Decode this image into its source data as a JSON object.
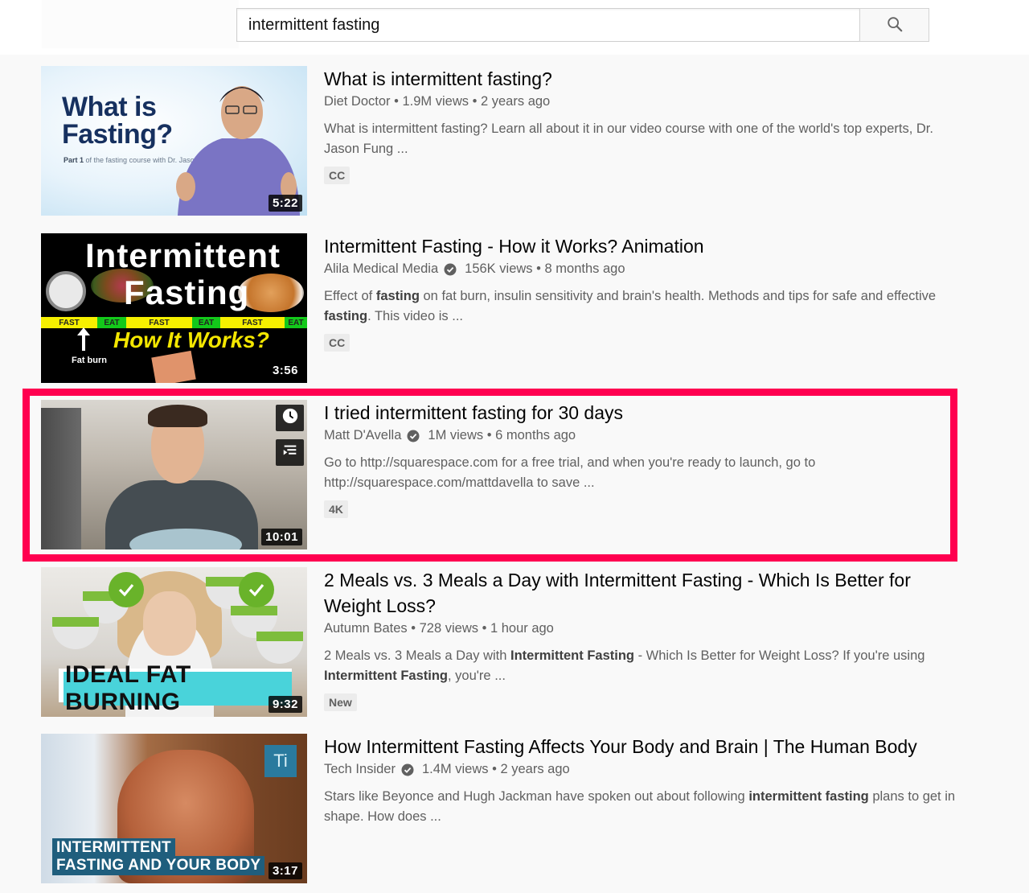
{
  "search": {
    "query": "intermittent fasting",
    "button_icon": "search-icon"
  },
  "colors": {
    "highlight": "#ff0050",
    "meta_text": "#606060",
    "title_text": "#030303"
  },
  "results": [
    {
      "title": "What is intermittent fasting?",
      "channel": "Diet Doctor",
      "verified": false,
      "views": "1.9M views",
      "age": "2 years ago",
      "separator": "•",
      "description": [
        {
          "text": "What is intermittent fasting? Learn all about it in our video course with one of the world's top experts, Dr. Jason Fung ...",
          "bold": false
        }
      ],
      "badge": "CC",
      "duration": "5:22",
      "thumbnail": {
        "headline": "What is Fasting?",
        "subtitle_bold": "Part 1",
        "subtitle": "of the fasting course with Dr. Jason Fung."
      }
    },
    {
      "title": "Intermittent Fasting - How it Works? Animation",
      "channel": "Alila Medical Media",
      "verified": true,
      "views": "156K views",
      "age": "8 months ago",
      "separator": "•",
      "description": [
        {
          "text": "Effect of ",
          "bold": false
        },
        {
          "text": "fasting",
          "bold": true
        },
        {
          "text": " on fat burn, insulin sensitivity and brain's health. Methods and tips for safe and effective ",
          "bold": false
        },
        {
          "text": "fasting",
          "bold": true
        },
        {
          "text": ". This video is ...",
          "bold": false
        }
      ],
      "badge": "CC",
      "duration": "3:56",
      "thumbnail": {
        "line1": "Intermittent",
        "line2": "Fasting",
        "bar": [
          "FAST",
          "EAT",
          "FAST",
          "EAT",
          "FAST",
          "EAT"
        ],
        "how": "How It Works?",
        "fat_burn": "Fat burn"
      }
    },
    {
      "title": "I tried intermittent fasting for 30 days",
      "channel": "Matt D'Avella",
      "verified": true,
      "views": "1M views",
      "age": "6 months ago",
      "separator": "•",
      "description": [
        {
          "text": "Go to http://squarespace.com for a free trial, and when you're ready to launch, go to http://squarespace.com/mattdavella to save ...",
          "bold": false
        }
      ],
      "badge": "4K",
      "duration": "10:01",
      "highlighted": true,
      "thumbnail": {
        "overlay_icons": [
          "watch-later-icon",
          "add-to-queue-icon"
        ]
      }
    },
    {
      "title": "2 Meals vs. 3 Meals a Day with Intermittent Fasting - Which Is Better for Weight Loss?",
      "channel": "Autumn Bates",
      "verified": false,
      "views": "728 views",
      "age": "1 hour ago",
      "separator": "•",
      "description": [
        {
          "text": "2 Meals vs. 3 Meals a Day with ",
          "bold": false
        },
        {
          "text": "Intermittent Fasting",
          "bold": true
        },
        {
          "text": " - Which Is Better for Weight Loss? If you're using ",
          "bold": false
        },
        {
          "text": "Intermittent Fasting",
          "bold": true
        },
        {
          "text": ", you're ...",
          "bold": false
        }
      ],
      "badge": "New",
      "duration": "9:32",
      "thumbnail": {
        "banner": "IDEAL FAT BURNING"
      }
    },
    {
      "title": "How Intermittent Fasting Affects Your Body and Brain | The Human Body",
      "channel": "Tech Insider",
      "verified": true,
      "views": "1.4M views",
      "age": "2 years ago",
      "separator": "•",
      "description": [
        {
          "text": "Stars like Beyonce and Hugh Jackman have spoken out about following ",
          "bold": false
        },
        {
          "text": "intermittent fasting",
          "bold": true
        },
        {
          "text": " plans to get in shape. How does ...",
          "bold": false
        }
      ],
      "badge": null,
      "duration": "3:17",
      "thumbnail": {
        "logo": "Ti",
        "caption1": "INTERMITTENT",
        "caption2": "FASTING AND YOUR BODY"
      }
    }
  ]
}
